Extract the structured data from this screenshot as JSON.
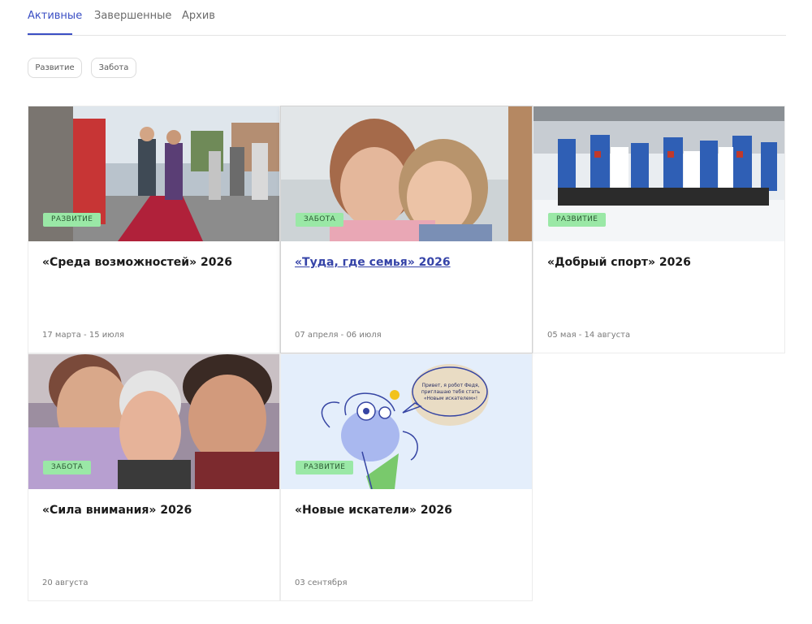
{
  "tabs": [
    {
      "label": "Активные",
      "active": true
    },
    {
      "label": "Завершенные",
      "active": false
    },
    {
      "label": "Архив",
      "active": false
    }
  ],
  "filters": [
    {
      "label": "Развитие"
    },
    {
      "label": "Забота"
    }
  ],
  "cards": [
    {
      "title": "«Среда возможностей» 2026",
      "badge": "РАЗВИТИЕ",
      "date": "17 марта - 15 июля",
      "image": "children-walking-photo",
      "hovered": false
    },
    {
      "title": "«Туда, где семья» 2026",
      "badge": "ЗАБОТА",
      "date": "07 апреля - 06 июля",
      "image": "two-girls-portrait-photo",
      "hovered": true
    },
    {
      "title": "«Добрый спорт» 2026",
      "badge": "РАЗВИТИЕ",
      "date": "05 мая - 14 августа",
      "image": "hockey-team-photo",
      "hovered": false
    },
    {
      "title": "«Сила внимания» 2026",
      "badge": "ЗАБОТА",
      "date": "20 августа",
      "image": "elderly-women-photo",
      "hovered": false
    },
    {
      "title": "«Новые искатели» 2026",
      "badge": "РАЗВИТИЕ",
      "date": "03 сентября",
      "image": "robot-fedya-illustration",
      "hovered": false
    }
  ],
  "speech_bubble": {
    "line1": "Привет, я робот Федя,",
    "line2": "приглашаю тебя стать",
    "line3": "«Новым искателем»!"
  },
  "colors": {
    "accent": "#3b4fc4",
    "badge_bg": "#9ae8a6",
    "badge_text": "#2c5a34",
    "hover_title": "#3644a8"
  }
}
